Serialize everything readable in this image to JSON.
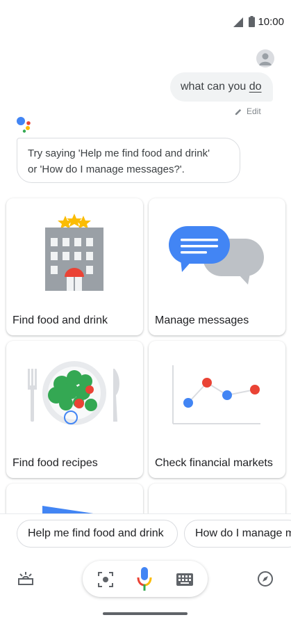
{
  "status_bar": {
    "time": "10:00",
    "icons": [
      "signal-icon",
      "battery-icon"
    ]
  },
  "conversation": {
    "user_query_before": "what can you ",
    "user_query_underlined": "do",
    "edit_label": "Edit",
    "assistant_line1": "Try saying 'Help me find food and drink'",
    "assistant_line2": "or 'How do I manage messages?'."
  },
  "cards": [
    {
      "label": "Find food and drink",
      "icon": "hotel-building-icon"
    },
    {
      "label": "Manage messages",
      "icon": "chat-bubbles-icon"
    },
    {
      "label": "Find food recipes",
      "icon": "salad-plate-icon"
    },
    {
      "label": "Check financial markets",
      "icon": "line-chart-icon"
    }
  ],
  "suggestion_chips": [
    "Help me find food and drink",
    "How do I manage messages?"
  ],
  "bottom_bar": {
    "icons": [
      "updates-icon",
      "lens-icon",
      "mic-icon",
      "keyboard-icon",
      "explore-icon"
    ]
  },
  "colors": {
    "blue": "#4285f4",
    "red": "#ea4335",
    "yellow": "#fbbc04",
    "green": "#34a853",
    "bubble_bg": "#f1f3f4"
  }
}
